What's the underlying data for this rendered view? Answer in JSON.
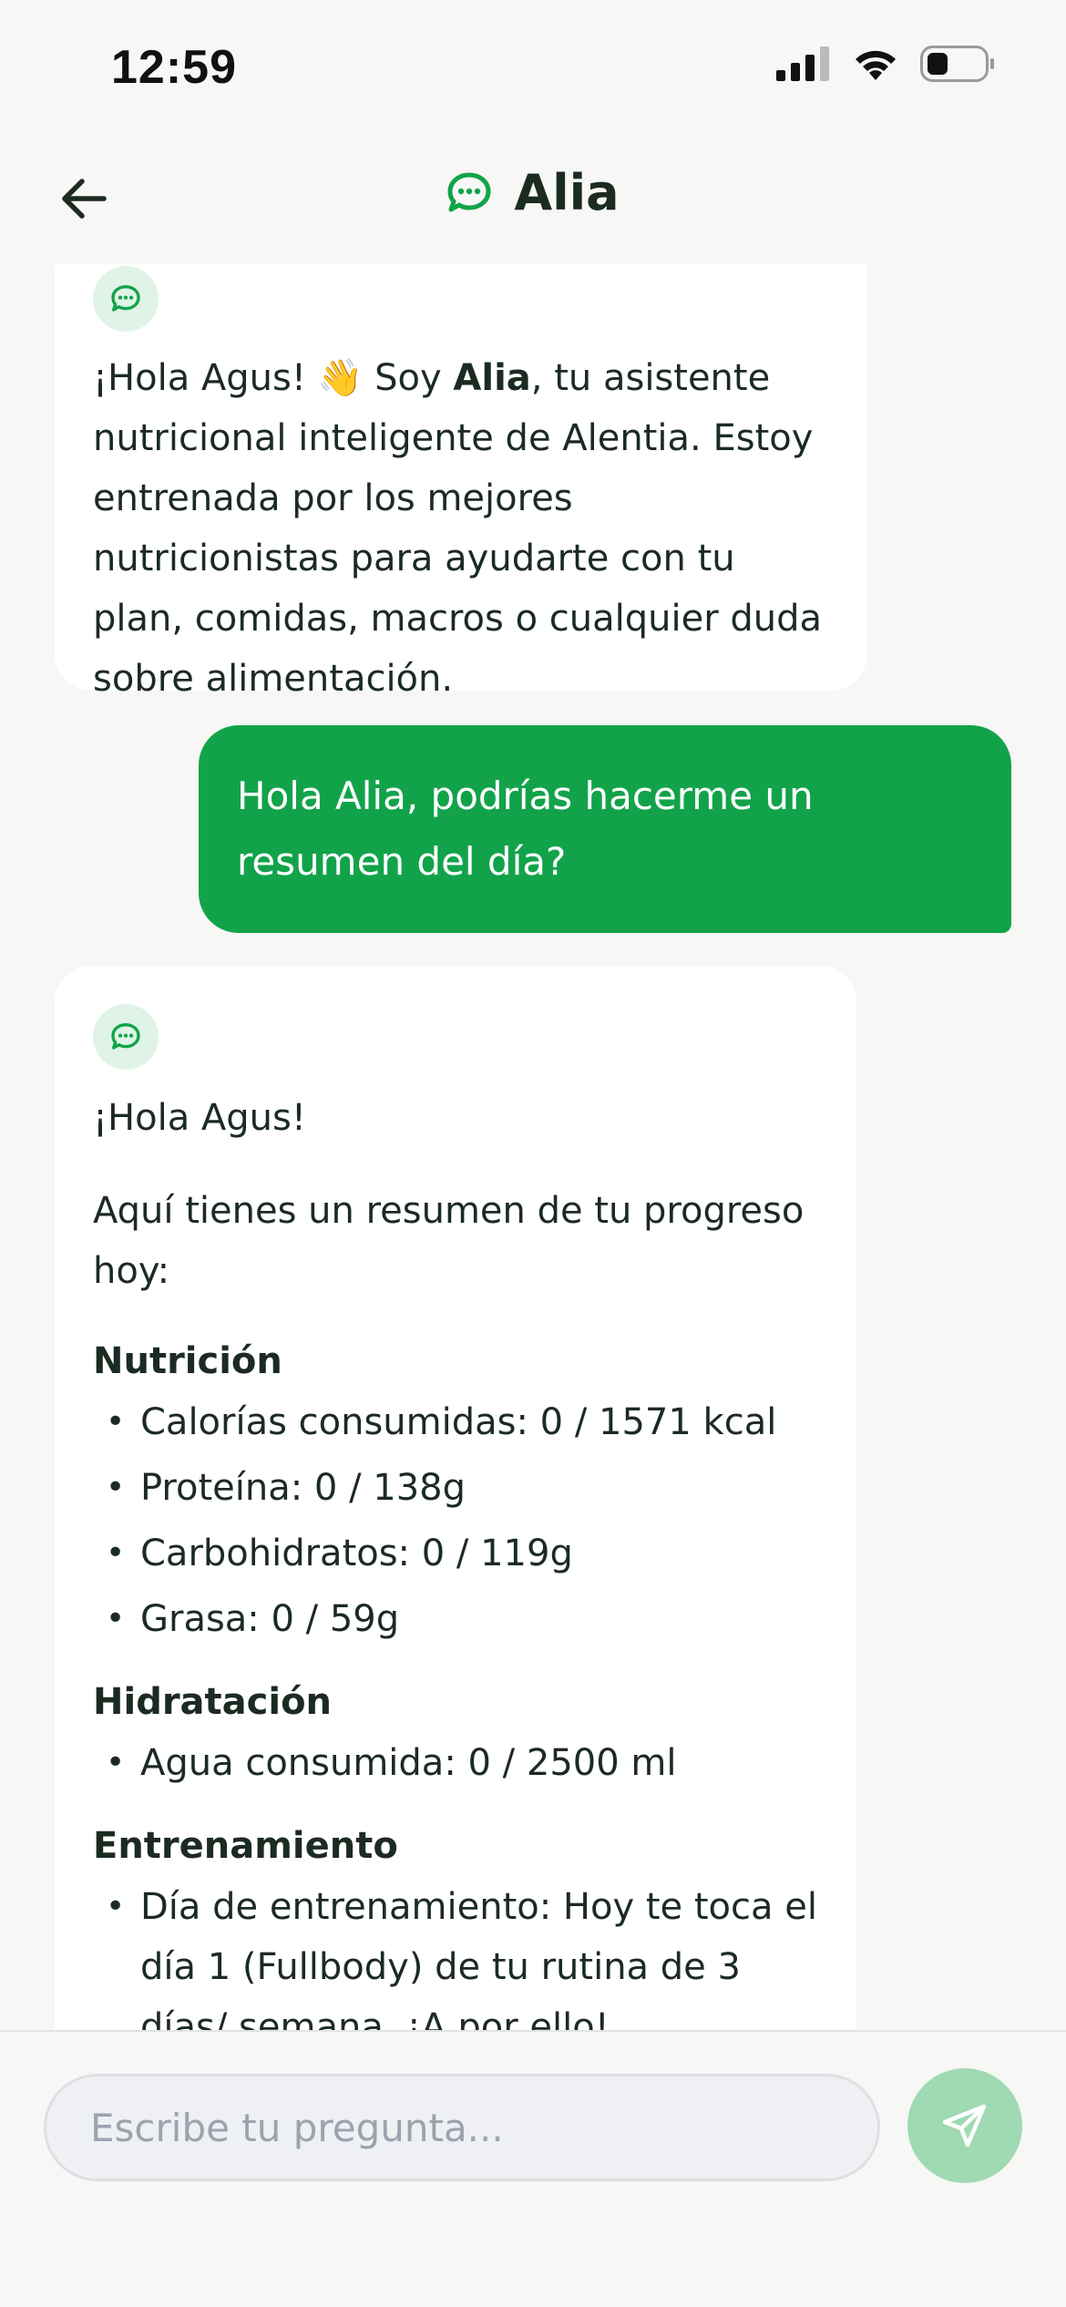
{
  "status_bar": {
    "time": "12:59"
  },
  "header": {
    "title": "Alia",
    "back_icon": "arrow-left-icon",
    "title_icon": "chat-bubble-icon"
  },
  "messages": {
    "bot_intro": {
      "greeting": "¡Hola Agus!",
      "emoji": "👋",
      "prefix": " Soy ",
      "name": "Alia",
      "suffix": ", tu asistente nutricional inteligente de Alentia. Estoy entrenada por los mejores nutricionistas para ayudarte con tu plan, comidas, macros o cualquier duda sobre alimentación."
    },
    "user_message": "Hola Alia, podrías hacerme un resumen del día?",
    "bot_summary": {
      "greeting": "¡Hola Agus!",
      "intro": "Aquí tienes un resumen de tu progreso hoy:",
      "sections": [
        {
          "title": "Nutrición",
          "items": [
            "Calorías consumidas: 0 / 1571 kcal",
            "Proteína: 0 / 138g",
            "Carbohidratos: 0 / 119g",
            "Grasa: 0 / 59g"
          ]
        },
        {
          "title": "Hidratación",
          "items": [
            "Agua consumida: 0 / 2500 ml"
          ]
        },
        {
          "title": "Entrenamiento",
          "items": [
            "Día de entrenamiento: Hoy te toca el día 1 (Fullbody) de tu rutina de 3 días/ semana. ¡A por ello!"
          ]
        }
      ]
    }
  },
  "composer": {
    "placeholder": "Escribe tu pregunta...",
    "send_icon": "send-icon"
  },
  "colors": {
    "accent": "#12a34a",
    "avatar_bg": "#dff3e6",
    "send_disabled": "#9fdab2"
  }
}
